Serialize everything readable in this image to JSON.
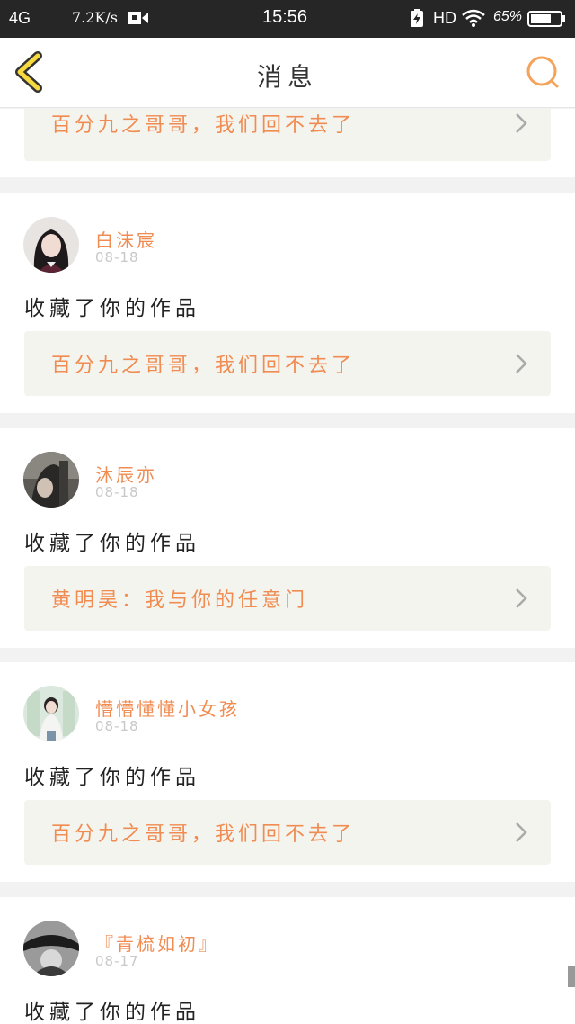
{
  "status": {
    "signal": "4G",
    "speed": "7.2K/s",
    "time": "15:56",
    "hd": "HD",
    "battery_pct": "65%"
  },
  "nav": {
    "title": "消息",
    "accent": "#f5a35a"
  },
  "items": [
    {
      "work": "百分九之哥哥，我们回不去了"
    },
    {
      "user": "白沫宸",
      "date": "08-18",
      "action": "收藏了你的作品",
      "work": "百分九之哥哥，我们回不去了"
    },
    {
      "user": "沐辰亦",
      "date": "08-18",
      "action": "收藏了你的作品",
      "work": "黄明昊：我与你的任意门"
    },
    {
      "user": "懵懵懂懂小女孩",
      "date": "08-18",
      "action": "收藏了你的作品",
      "work": "百分九之哥哥，我们回不去了"
    },
    {
      "user": "『青梳如初』",
      "date": "08-17",
      "action": "收藏了你的作品"
    }
  ],
  "colors": {
    "link_text": "#f08c52",
    "box_bg": "#f4f4ee",
    "date_text": "#c8c8c8"
  }
}
